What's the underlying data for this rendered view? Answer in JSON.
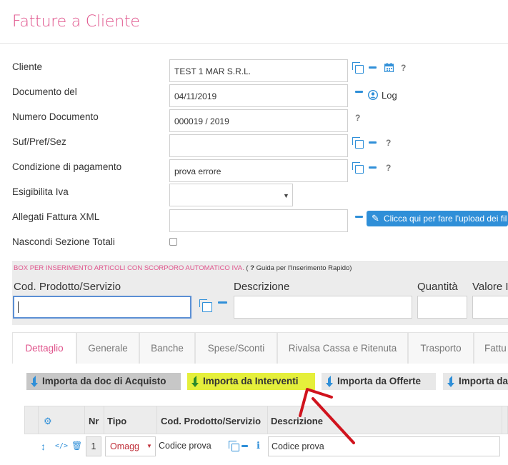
{
  "page": {
    "title": "Fatture a Cliente"
  },
  "form": {
    "cliente": {
      "label": "Cliente",
      "value": "TEST 1 MAR S.R.L."
    },
    "documento_del": {
      "label": "Documento del",
      "value": "04/11/2019",
      "log_label": "Log"
    },
    "numero_documento": {
      "label": "Numero Documento",
      "value": "000019 / 2019"
    },
    "suf_pref_sez": {
      "label": "Suf/Pref/Sez",
      "value": ""
    },
    "condizione_pagamento": {
      "label": "Condizione di pagamento",
      "value": "prova errore"
    },
    "esigibilita_iva": {
      "label": "Esigibilita Iva",
      "value": ""
    },
    "allegati_xml": {
      "label": "Allegati Fattura XML",
      "value": "",
      "upload_label": "Clicca qui per fare l'upload dei fil"
    },
    "nascondi_totali": {
      "label": "Nascondi Sezione Totali",
      "checked": false
    },
    "help_mark": "?"
  },
  "box": {
    "title": "BOX PER INSERIMENTO ARTICOLI CON SCORPORO AUTOMATICO IVA.",
    "guide_open": " ( ",
    "guide_mark": "?",
    "guide_text": " Guida per l'Inserimento Rapido)",
    "fields": {
      "cod_prodotto": "Cod. Prodotto/Servizio",
      "descrizione": "Descrizione",
      "quantita": "Quantità",
      "valore": "Valore I"
    }
  },
  "tabs": [
    {
      "label": "Dettaglio",
      "active": true
    },
    {
      "label": "Generale"
    },
    {
      "label": "Banche"
    },
    {
      "label": "Spese/Sconti"
    },
    {
      "label": "Rivalsa Cassa e Ritenuta"
    },
    {
      "label": "Trasporto"
    },
    {
      "label": "Fattu"
    }
  ],
  "import_buttons": {
    "acquisto": "Importa da doc di Acquisto",
    "interventi": "Importa da Interventi",
    "offerte": "Importa da Offerte",
    "other": "Importa da"
  },
  "grid": {
    "headers": {
      "nr": "Nr",
      "tipo": "Tipo",
      "cod": "Cod. Prodotto/Servizio",
      "descrizione": "Descrizione"
    },
    "rows": [
      {
        "nr": "1",
        "tipo": "Omagg",
        "cod": "Codice prova",
        "descrizione": "Codice prova",
        "info": "i"
      }
    ]
  },
  "colors": {
    "accent": "#e0548c",
    "icon_blue": "#2f8fd8",
    "highlight": "#e5ef3b",
    "arrow_red": "#d0131d"
  }
}
